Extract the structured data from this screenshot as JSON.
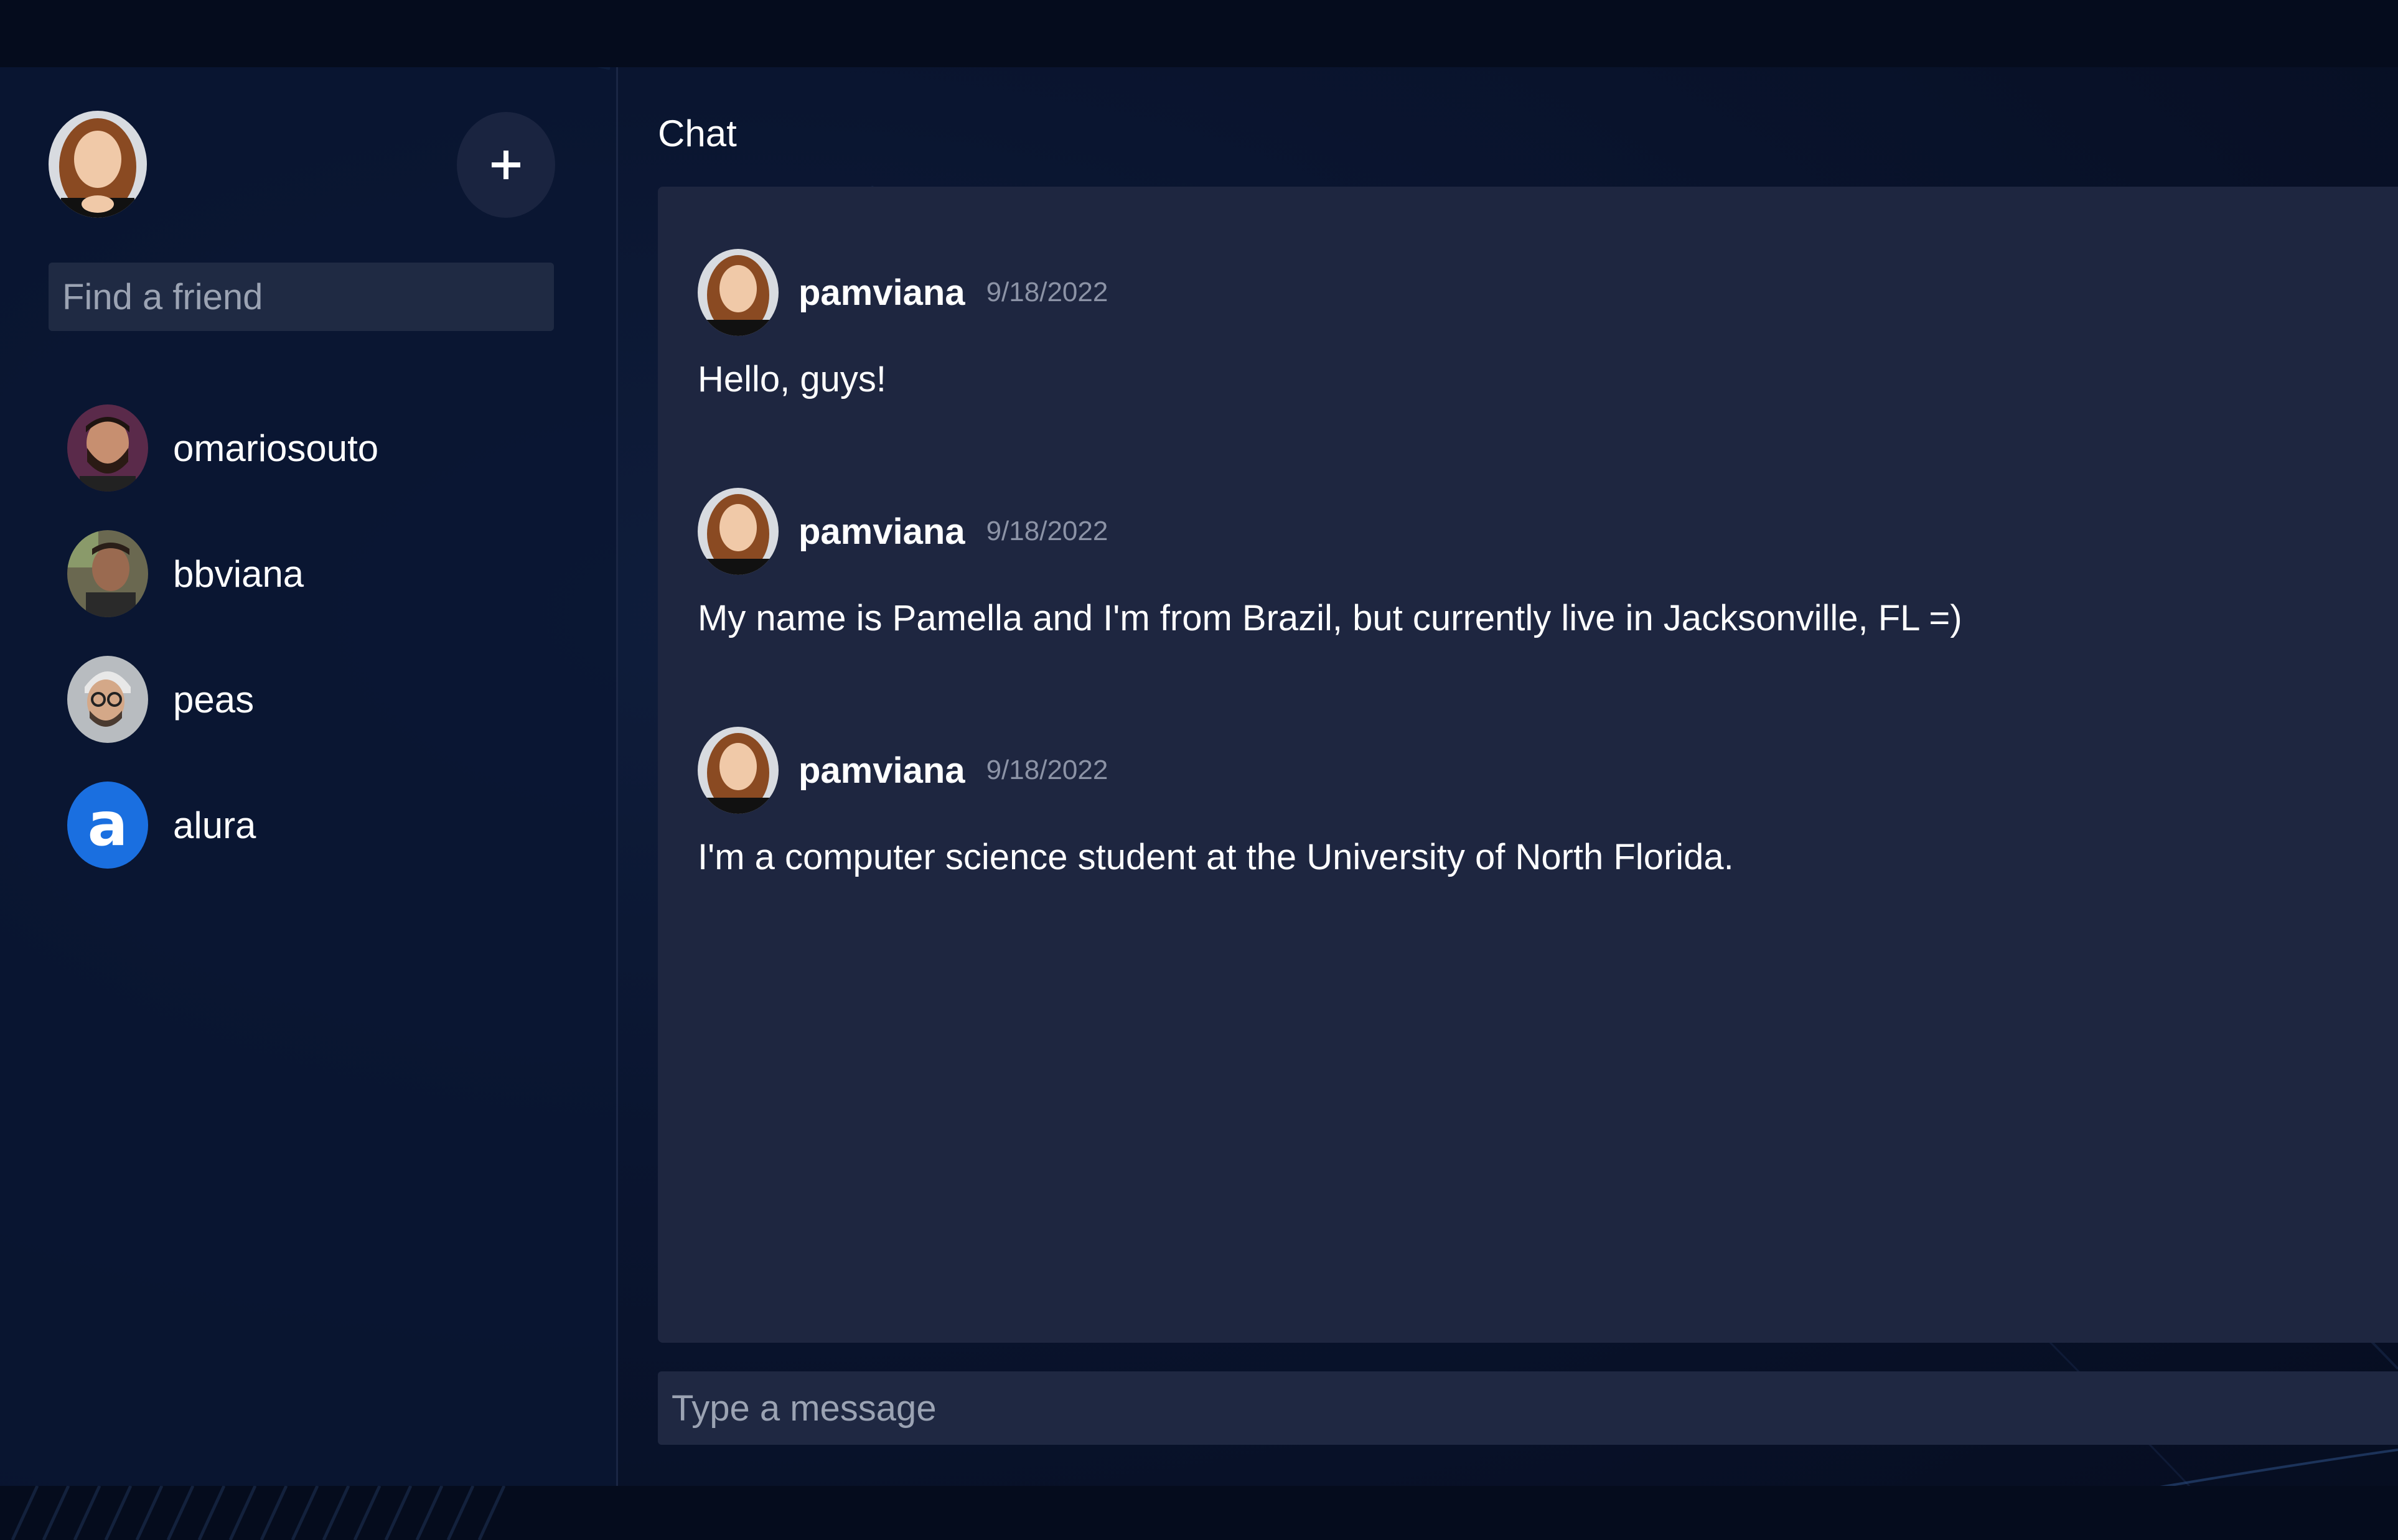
{
  "sidebar": {
    "current_user": {
      "avatar": "avatar-woman-long-hair"
    },
    "add_button": {
      "label": "+",
      "icon": "plus-icon"
    },
    "search": {
      "placeholder": "Find a friend",
      "value": ""
    },
    "friends": [
      {
        "name": "omariosouto",
        "avatar": "avatar-man-beard"
      },
      {
        "name": "bbviana",
        "avatar": "avatar-man-dark"
      },
      {
        "name": "peas",
        "avatar": "avatar-man-glasses"
      },
      {
        "name": "alura",
        "avatar": "alura-logo"
      }
    ]
  },
  "chat": {
    "title": "Chat",
    "messages": [
      {
        "author": "pamviana",
        "date": "9/18/2022",
        "text": "Hello, guys!"
      },
      {
        "author": "pamviana",
        "date": "9/18/2022",
        "text": "My name is Pamella and I'm from Brazil, but currently live in Jacksonville, FL =)"
      },
      {
        "author": "pamviana",
        "date": "9/18/2022",
        "text": "I'm a computer science student at the University of North Florida."
      }
    ],
    "input": {
      "placeholder": "Type a message",
      "value": ""
    }
  },
  "colors": {
    "background": "#081126",
    "panel": "#1e2640",
    "input": "#1f2842",
    "alura_blue": "#1a6fe0",
    "muted_text": "#8c93a6"
  }
}
